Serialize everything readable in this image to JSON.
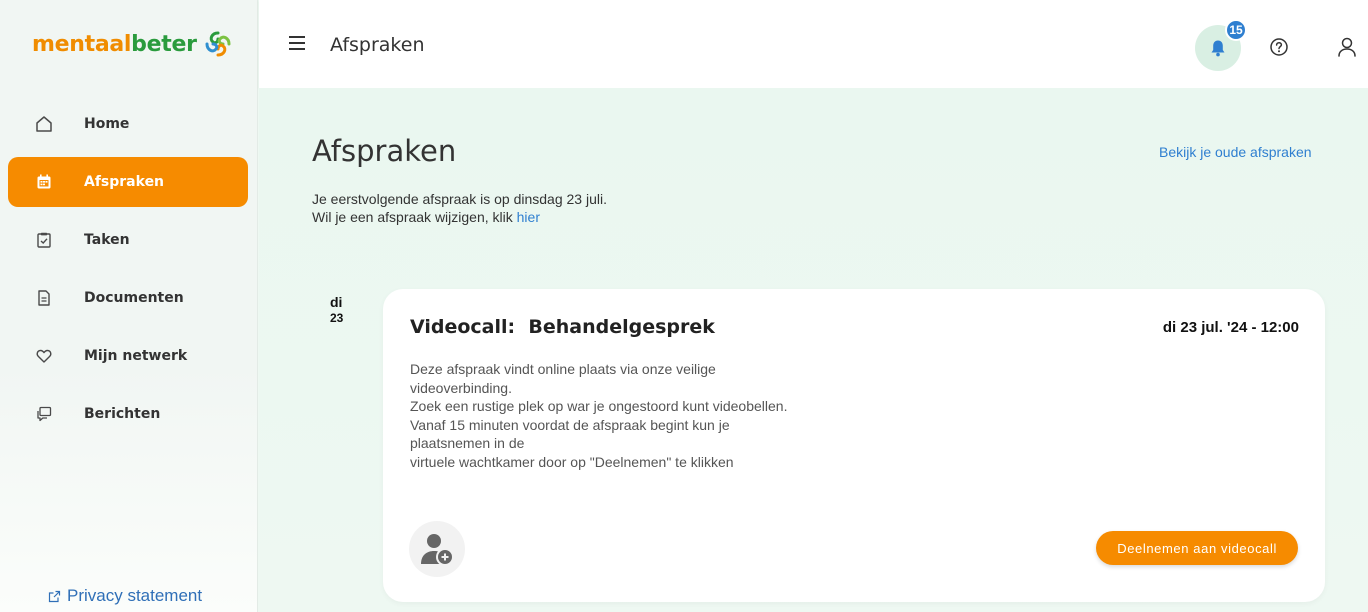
{
  "logo": {
    "part1": "mentaal",
    "part2": "beter"
  },
  "sidebar": {
    "items": [
      {
        "label": "Home",
        "icon": "home-icon"
      },
      {
        "label": "Afspraken",
        "icon": "calendar-icon",
        "active": true
      },
      {
        "label": "Taken",
        "icon": "checklist-icon"
      },
      {
        "label": "Documenten",
        "icon": "document-icon"
      },
      {
        "label": "Mijn netwerk",
        "icon": "heart-icon"
      },
      {
        "label": "Berichten",
        "icon": "chat-icon"
      }
    ],
    "privacy": "Privacy statement"
  },
  "header": {
    "title": "Afspraken",
    "notification_count": "15"
  },
  "main": {
    "title": "Afspraken",
    "old_link": "Bekijk je oude afspraken",
    "intro_line1": "Je eerstvolgende afspraak is op dinsdag 23 juli.",
    "intro_line2": "Wil je een afspraak wijzigen, klik ",
    "intro_link": "hier",
    "day_short": "di",
    "day_num": "23"
  },
  "appointment": {
    "title": "Videocall:  Behandelgesprek",
    "datetime": "di 23 jul. '24 - 12:00",
    "desc_lines": [
      "Deze afspraak vindt online plaats via onze veilige",
      "videoverbinding.",
      "Zoek een rustige plek op war je ongestoord kunt videobellen.",
      "Vanaf 15 minuten voordat de afspraak begint kun je",
      "plaatsnemen in de",
      "virtuele wachtkamer door op \"Deelnemen\" te klikken"
    ],
    "join_label": "Deelnemen aan videocall"
  },
  "colors": {
    "accent": "#f68b00",
    "brand_green": "#2a9b3d",
    "link": "#2f7fd0"
  }
}
